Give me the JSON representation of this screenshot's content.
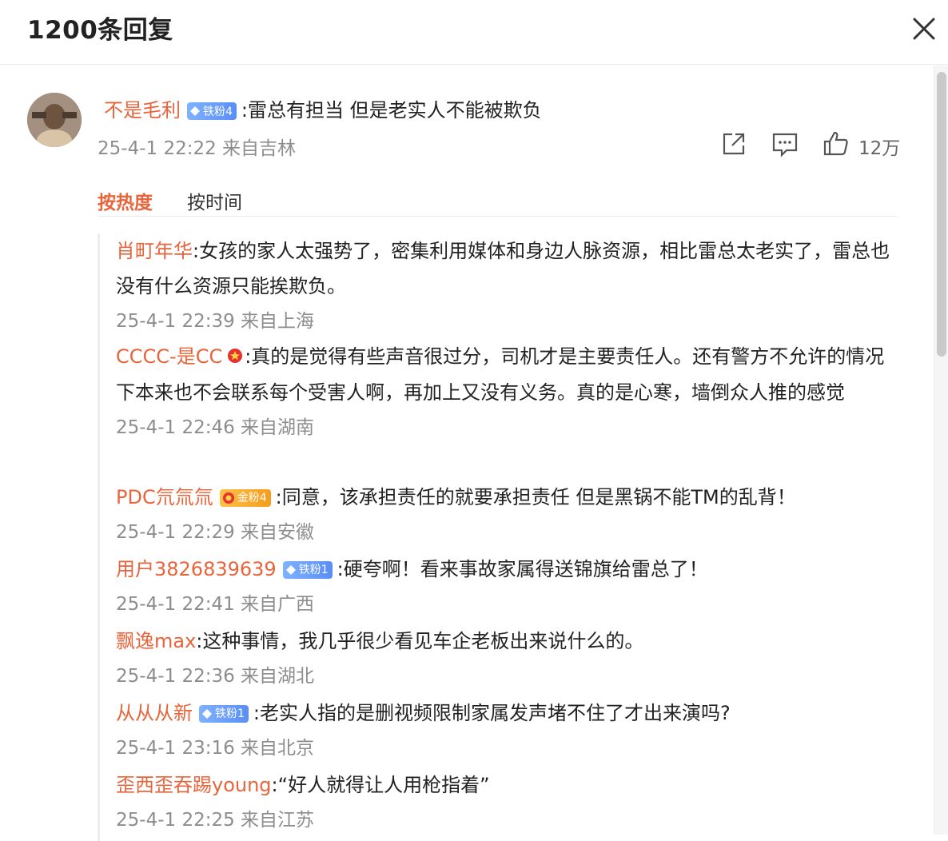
{
  "header": {
    "title": "1200条回复"
  },
  "main_comment": {
    "author": "不是毛利",
    "badge": "铁粉4",
    "text": ":雷总有担当 但是老实人不能被欺负",
    "meta": "25-4-1 22:22 来自吉林",
    "likes": "12万"
  },
  "sort_tabs": {
    "hot": "按热度",
    "time": "按时间"
  },
  "replies": [
    {
      "author": "肖町年华",
      "text": ":女孩的家人太强势了，密集利用媒体和身边人脉资源，相比雷总太老实了，雷总也没有什么资源只能挨欺负。",
      "meta": "25-4-1 22:39 来自上海"
    },
    {
      "author": "CCCC-是CC",
      "text": ":真的是觉得有些声音很过分，司机才是主要责任人。还有警方不允许的情况下本来也不会联系每个受害人啊，再加上又没有义务。真的是心寒，墙倒众人推的感觉",
      "meta": "25-4-1 22:46 来自湖南"
    },
    {
      "author": "PDC氘氚氚",
      "badge": "金粉4",
      "text": ":同意，该承担责任的就要承担责任 但是黑锅不能TM的乱背！",
      "meta": "25-4-1 22:29 来自安徽"
    },
    {
      "author": "用户3826839639",
      "badge": "铁粉1",
      "text": ":硬夸啊！看来事故家属得送锦旗给雷总了！",
      "meta": "25-4-1 22:41 来自广西"
    },
    {
      "author": "飘逸max",
      "text": ":这种事情，我几乎很少看见车企老板出来说什么的。",
      "meta": "25-4-1 22:36 来自湖北"
    },
    {
      "author": "从从从新",
      "badge": "铁粉1",
      "text": ":老实人指的是删视频限制家属发声堵不住了才出来演吗?",
      "meta": "25-4-1 23:16 来自北京"
    },
    {
      "author": "歪西歪吞踢young",
      "text": ":“好人就得让人用枪指着”",
      "meta": "25-4-1 22:25 来自江苏"
    }
  ],
  "colors": {
    "accent": "#e8643b",
    "iron_badge": "#6a9cf8",
    "gold_badge": "#f5a623",
    "meta_gray": "#8d8d8d"
  },
  "icons": [
    "close-icon",
    "share-icon",
    "comment-icon",
    "like-icon",
    "diamond-icon",
    "vip-icon",
    "gold-badge-icon"
  ]
}
